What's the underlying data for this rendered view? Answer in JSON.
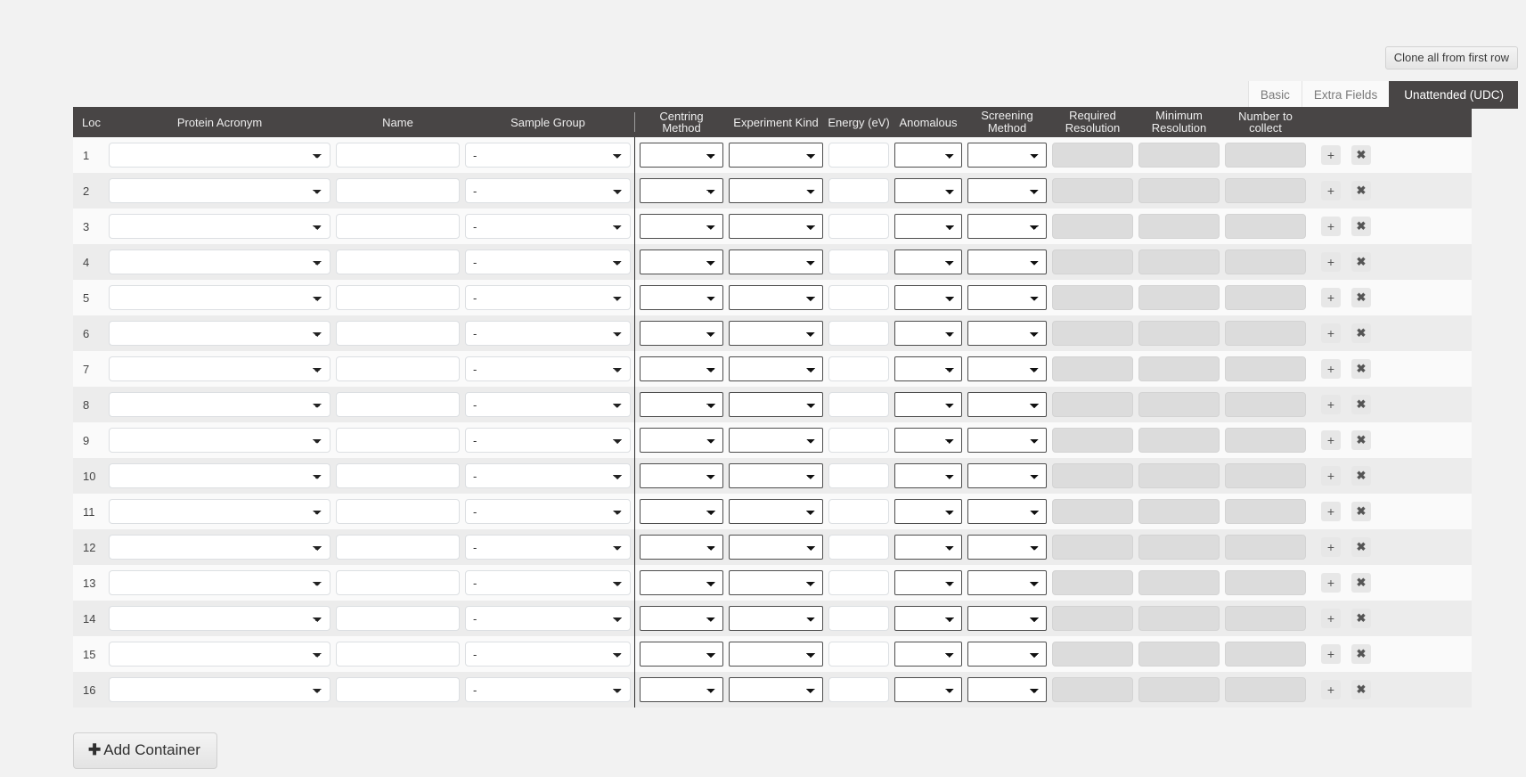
{
  "toolbar": {
    "clone_label": "Clone all from first row"
  },
  "tabs": [
    {
      "label": "Basic",
      "active": false
    },
    {
      "label": "Extra Fields",
      "active": false
    },
    {
      "label": "Unattended (UDC)",
      "active": true
    }
  ],
  "table": {
    "columns": [
      {
        "key": "loc",
        "label": "Loc",
        "align": "left"
      },
      {
        "key": "protein",
        "label": "Protein Acronym",
        "align": "center"
      },
      {
        "key": "name",
        "label": "Name",
        "align": "center"
      },
      {
        "key": "group",
        "label": "Sample Group",
        "align": "center"
      },
      {
        "key": "centring",
        "label": "Centring Method",
        "align": "center"
      },
      {
        "key": "expkind",
        "label": "Experiment Kind",
        "align": "center"
      },
      {
        "key": "energy",
        "label": "Energy (eV)",
        "align": "center"
      },
      {
        "key": "anomalous",
        "label": "Anomalous",
        "align": "center"
      },
      {
        "key": "screening",
        "label": "Screening Method",
        "align": "center"
      },
      {
        "key": "reqres",
        "label": "Required Resolution",
        "align": "center"
      },
      {
        "key": "minres",
        "label": "Minimum Resolution",
        "align": "center"
      },
      {
        "key": "numcol",
        "label": "Number to collect",
        "align": "center"
      }
    ],
    "rows": [
      {
        "loc": "1",
        "protein": "",
        "name": "",
        "group": "-",
        "centring": "",
        "expkind": "",
        "energy": "",
        "anomalous": "",
        "screening": "",
        "reqres": "",
        "minres": "",
        "numcol": ""
      },
      {
        "loc": "2",
        "protein": "",
        "name": "",
        "group": "-",
        "centring": "",
        "expkind": "",
        "energy": "",
        "anomalous": "",
        "screening": "",
        "reqres": "",
        "minres": "",
        "numcol": ""
      },
      {
        "loc": "3",
        "protein": "",
        "name": "",
        "group": "-",
        "centring": "",
        "expkind": "",
        "energy": "",
        "anomalous": "",
        "screening": "",
        "reqres": "",
        "minres": "",
        "numcol": ""
      },
      {
        "loc": "4",
        "protein": "",
        "name": "",
        "group": "-",
        "centring": "",
        "expkind": "",
        "energy": "",
        "anomalous": "",
        "screening": "",
        "reqres": "",
        "minres": "",
        "numcol": ""
      },
      {
        "loc": "5",
        "protein": "",
        "name": "",
        "group": "-",
        "centring": "",
        "expkind": "",
        "energy": "",
        "anomalous": "",
        "screening": "",
        "reqres": "",
        "minres": "",
        "numcol": ""
      },
      {
        "loc": "6",
        "protein": "",
        "name": "",
        "group": "-",
        "centring": "",
        "expkind": "",
        "energy": "",
        "anomalous": "",
        "screening": "",
        "reqres": "",
        "minres": "",
        "numcol": ""
      },
      {
        "loc": "7",
        "protein": "",
        "name": "",
        "group": "-",
        "centring": "",
        "expkind": "",
        "energy": "",
        "anomalous": "",
        "screening": "",
        "reqres": "",
        "minres": "",
        "numcol": ""
      },
      {
        "loc": "8",
        "protein": "",
        "name": "",
        "group": "-",
        "centring": "",
        "expkind": "",
        "energy": "",
        "anomalous": "",
        "screening": "",
        "reqres": "",
        "minres": "",
        "numcol": ""
      },
      {
        "loc": "9",
        "protein": "",
        "name": "",
        "group": "-",
        "centring": "",
        "expkind": "",
        "energy": "",
        "anomalous": "",
        "screening": "",
        "reqres": "",
        "minres": "",
        "numcol": ""
      },
      {
        "loc": "10",
        "protein": "",
        "name": "",
        "group": "-",
        "centring": "",
        "expkind": "",
        "energy": "",
        "anomalous": "",
        "screening": "",
        "reqres": "",
        "minres": "",
        "numcol": ""
      },
      {
        "loc": "11",
        "protein": "",
        "name": "",
        "group": "-",
        "centring": "",
        "expkind": "",
        "energy": "",
        "anomalous": "",
        "screening": "",
        "reqres": "",
        "minres": "",
        "numcol": ""
      },
      {
        "loc": "12",
        "protein": "",
        "name": "",
        "group": "-",
        "centring": "",
        "expkind": "",
        "energy": "",
        "anomalous": "",
        "screening": "",
        "reqres": "",
        "minres": "",
        "numcol": ""
      },
      {
        "loc": "13",
        "protein": "",
        "name": "",
        "group": "-",
        "centring": "",
        "expkind": "",
        "energy": "",
        "anomalous": "",
        "screening": "",
        "reqres": "",
        "minres": "",
        "numcol": ""
      },
      {
        "loc": "14",
        "protein": "",
        "name": "",
        "group": "-",
        "centring": "",
        "expkind": "",
        "energy": "",
        "anomalous": "",
        "screening": "",
        "reqres": "",
        "minres": "",
        "numcol": ""
      },
      {
        "loc": "15",
        "protein": "",
        "name": "",
        "group": "-",
        "centring": "",
        "expkind": "",
        "energy": "",
        "anomalous": "",
        "screening": "",
        "reqres": "",
        "minres": "",
        "numcol": ""
      },
      {
        "loc": "16",
        "protein": "",
        "name": "",
        "group": "-",
        "centring": "",
        "expkind": "",
        "energy": "",
        "anomalous": "",
        "screening": "",
        "reqres": "",
        "minres": "",
        "numcol": ""
      }
    ],
    "row_actions": {
      "add_icon": "plus-icon",
      "add_label": "+",
      "remove_icon": "close-icon",
      "remove_label": "✖"
    },
    "disabled_columns": [
      "reqres",
      "minres",
      "numcol"
    ]
  },
  "footer": {
    "add_container_label": "Add Container",
    "add_container_icon": "plus-icon",
    "add_container_plus": "➕"
  },
  "colors": {
    "header_bg": "#484545",
    "page_bg": "#f2f2f2",
    "row_bg": "#fafafa",
    "row_alt_bg": "#ececec",
    "active_tab_bg": "#484545",
    "disabled_field_bg": "#dcdcdc"
  }
}
